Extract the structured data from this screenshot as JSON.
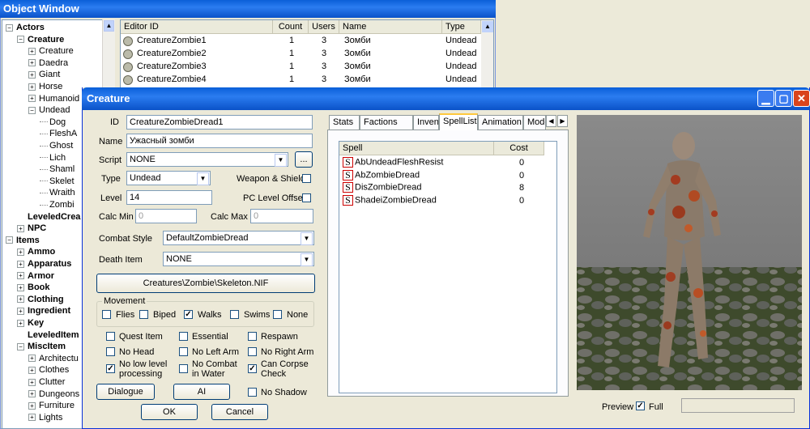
{
  "object_window": {
    "title": "Object Window",
    "tree": [
      {
        "label": "Actors",
        "level": 0,
        "bold": true,
        "toggle": "−"
      },
      {
        "label": "Creature",
        "level": 1,
        "bold": true,
        "toggle": "−"
      },
      {
        "label": "Creature",
        "level": 2,
        "bold": false,
        "toggle": "+"
      },
      {
        "label": "Daedra",
        "level": 2,
        "bold": false,
        "toggle": "+"
      },
      {
        "label": "Giant",
        "level": 2,
        "bold": false,
        "toggle": "+"
      },
      {
        "label": "Horse",
        "level": 2,
        "bold": false,
        "toggle": "+"
      },
      {
        "label": "Humanoid",
        "level": 2,
        "bold": false,
        "toggle": "+"
      },
      {
        "label": "Undead",
        "level": 2,
        "bold": false,
        "toggle": "−"
      },
      {
        "label": "Dog",
        "level": 3,
        "bold": false,
        "toggle": ""
      },
      {
        "label": "FleshA",
        "level": 3,
        "bold": false,
        "toggle": ""
      },
      {
        "label": "Ghost",
        "level": 3,
        "bold": false,
        "toggle": ""
      },
      {
        "label": "Lich",
        "level": 3,
        "bold": false,
        "toggle": ""
      },
      {
        "label": "Shaml",
        "level": 3,
        "bold": false,
        "toggle": ""
      },
      {
        "label": "Skelet",
        "level": 3,
        "bold": false,
        "toggle": ""
      },
      {
        "label": "Wraith",
        "level": 3,
        "bold": false,
        "toggle": ""
      },
      {
        "label": "Zombi",
        "level": 3,
        "bold": false,
        "toggle": ""
      },
      {
        "label": "LeveledCrea",
        "level": 1,
        "bold": true,
        "toggle": ""
      },
      {
        "label": "NPC",
        "level": 1,
        "bold": true,
        "toggle": "+"
      },
      {
        "label": "Items",
        "level": 0,
        "bold": true,
        "toggle": "−"
      },
      {
        "label": "Ammo",
        "level": 1,
        "bold": true,
        "toggle": "+"
      },
      {
        "label": "Apparatus",
        "level": 1,
        "bold": true,
        "toggle": "+"
      },
      {
        "label": "Armor",
        "level": 1,
        "bold": true,
        "toggle": "+"
      },
      {
        "label": "Book",
        "level": 1,
        "bold": true,
        "toggle": "+"
      },
      {
        "label": "Clothing",
        "level": 1,
        "bold": true,
        "toggle": "+"
      },
      {
        "label": "Ingredient",
        "level": 1,
        "bold": true,
        "toggle": "+"
      },
      {
        "label": "Key",
        "level": 1,
        "bold": true,
        "toggle": "+"
      },
      {
        "label": "LeveledItem",
        "level": 1,
        "bold": true,
        "toggle": ""
      },
      {
        "label": "MiscItem",
        "level": 1,
        "bold": true,
        "toggle": "−"
      },
      {
        "label": "Architectu",
        "level": 2,
        "bold": false,
        "toggle": "+"
      },
      {
        "label": "Clothes",
        "level": 2,
        "bold": false,
        "toggle": "+"
      },
      {
        "label": "Clutter",
        "level": 2,
        "bold": false,
        "toggle": "+"
      },
      {
        "label": "Dungeons",
        "level": 2,
        "bold": false,
        "toggle": "+"
      },
      {
        "label": "Furniture",
        "level": 2,
        "bold": false,
        "toggle": "+"
      },
      {
        "label": "Lights",
        "level": 2,
        "bold": false,
        "toggle": "+"
      }
    ],
    "columns": [
      "Editor ID",
      "Count",
      "Users",
      "Name",
      "Type"
    ],
    "rows": [
      [
        "CreatureZombie1",
        "1",
        "3",
        "Зомби",
        "Undead"
      ],
      [
        "CreatureZombie2",
        "1",
        "3",
        "Зомби",
        "Undead"
      ],
      [
        "CreatureZombie3",
        "1",
        "3",
        "Зомби",
        "Undead"
      ],
      [
        "CreatureZombie4",
        "1",
        "3",
        "Зомби",
        "Undead"
      ]
    ]
  },
  "dialog": {
    "title": "Creature",
    "id_label": "ID",
    "id_value": "CreatureZombieDread1",
    "name_label": "Name",
    "name_value": "Ужасный зомби",
    "script_label": "Script",
    "script_value": "NONE",
    "script_btn": "...",
    "type_label": "Type",
    "type_value": "Undead",
    "weapon_shield": "Weapon & Shield",
    "level_label": "Level",
    "level_value": "14",
    "pc_level_offset": "PC Level Offset",
    "calc_min_label": "Calc Min",
    "calc_min_value": "0",
    "calc_max_label": "Calc Max",
    "calc_max_value": "0",
    "combat_style_label": "Combat Style",
    "combat_style_value": "DefaultZombieDread",
    "death_item_label": "Death Item",
    "death_item_value": "NONE",
    "model_path": "Creatures\\Zombie\\Skeleton.NIF",
    "movement_label": "Movement",
    "movement": [
      {
        "label": "Flies",
        "checked": ""
      },
      {
        "label": "Biped",
        "checked": ""
      },
      {
        "label": "Walks",
        "checked": "✓"
      },
      {
        "label": "Swims",
        "checked": ""
      },
      {
        "label": "None",
        "checked": ""
      }
    ],
    "flags": {
      "quest_item": {
        "label": "Quest Item",
        "checked": ""
      },
      "essential": {
        "label": "Essential",
        "checked": ""
      },
      "respawn": {
        "label": "Respawn",
        "checked": ""
      },
      "no_head": {
        "label": "No Head",
        "checked": ""
      },
      "no_left_arm": {
        "label": "No Left Arm",
        "checked": ""
      },
      "no_right_arm": {
        "label": "No Right Arm",
        "checked": ""
      },
      "no_low_level_1": "No low level",
      "no_low_level_2": "processing",
      "no_low_level_checked": "✓",
      "no_combat_1": "No Combat",
      "no_combat_2": "in Water",
      "no_combat_checked": "",
      "can_corpse_1": "Can Corpse",
      "can_corpse_2": "Check",
      "can_corpse_checked": "✓",
      "no_shadow": {
        "label": "No Shadow",
        "checked": ""
      }
    },
    "dialogue_btn": "Dialogue",
    "ai_btn": "AI",
    "ok_btn": "OK",
    "cancel_btn": "Cancel",
    "tabs": [
      "Stats",
      "Factions",
      "Inventory",
      "SpellList",
      "Animation",
      "Mode"
    ],
    "active_tab": "SpellList",
    "spell_columns": [
      "Spell",
      "Cost"
    ],
    "spells": [
      {
        "name": "AbUndeadFleshResist",
        "cost": "0"
      },
      {
        "name": "AbZombieDread",
        "cost": "0"
      },
      {
        "name": "DisZombieDread",
        "cost": "8"
      },
      {
        "name": "ShadeiZombieDread",
        "cost": "0"
      }
    ],
    "spell_icon": "S",
    "preview_label": "Preview",
    "full_label": "Full",
    "full_checked": "✓"
  }
}
